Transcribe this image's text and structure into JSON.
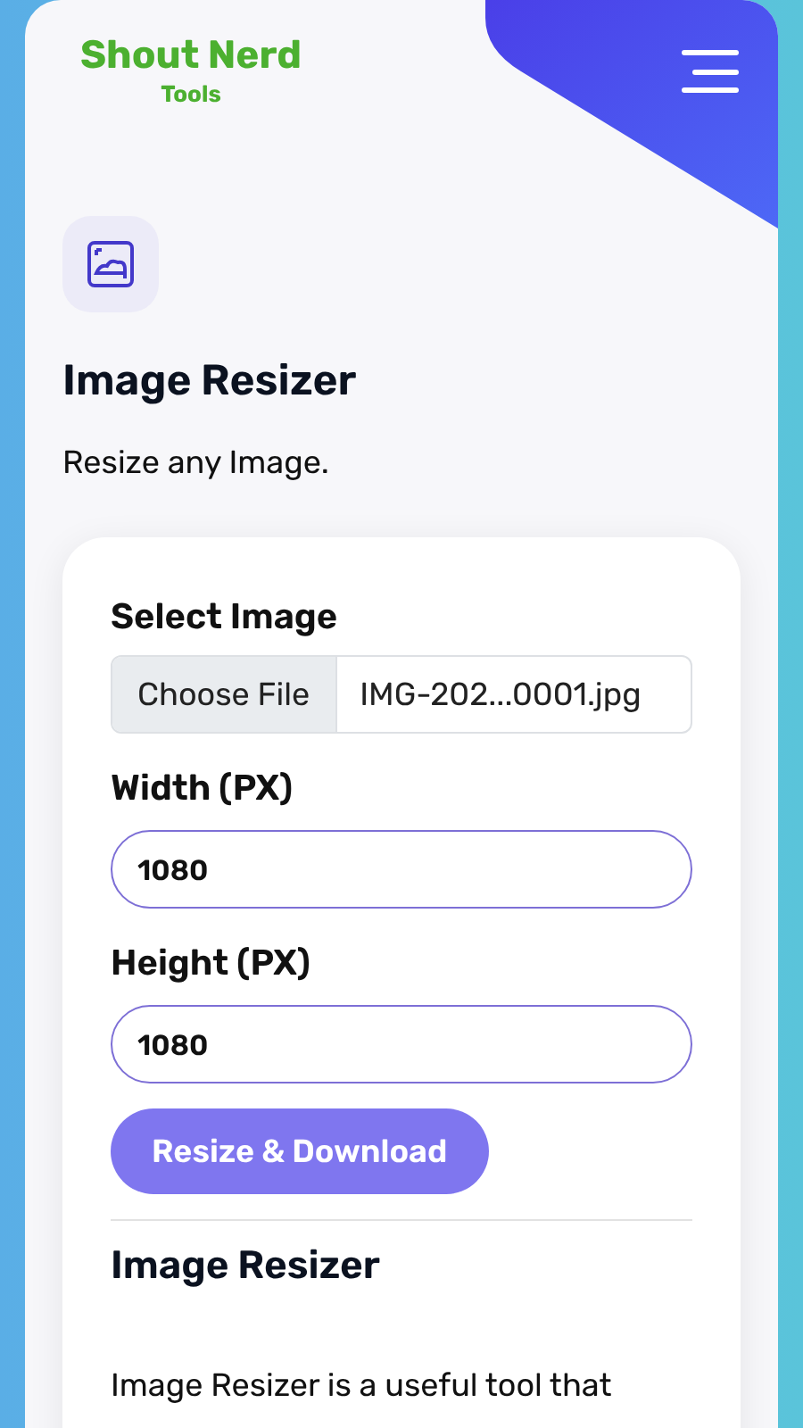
{
  "logo": {
    "title": "Shout Nerd",
    "subtitle": "Tools"
  },
  "page": {
    "title": "Image Resizer",
    "subtitle": "Resize any Image."
  },
  "form": {
    "file_label": "Select Image",
    "file_button": "Choose File",
    "file_name": "IMG-202...0001.jpg",
    "fields": [
      {
        "label": "Width (PX)",
        "value": "1080"
      },
      {
        "label": "Height (PX)",
        "value": "1080"
      }
    ],
    "submit": "Resize & Download"
  },
  "about": {
    "title": "Image Resizer",
    "text": "Image Resizer is a useful tool that"
  }
}
